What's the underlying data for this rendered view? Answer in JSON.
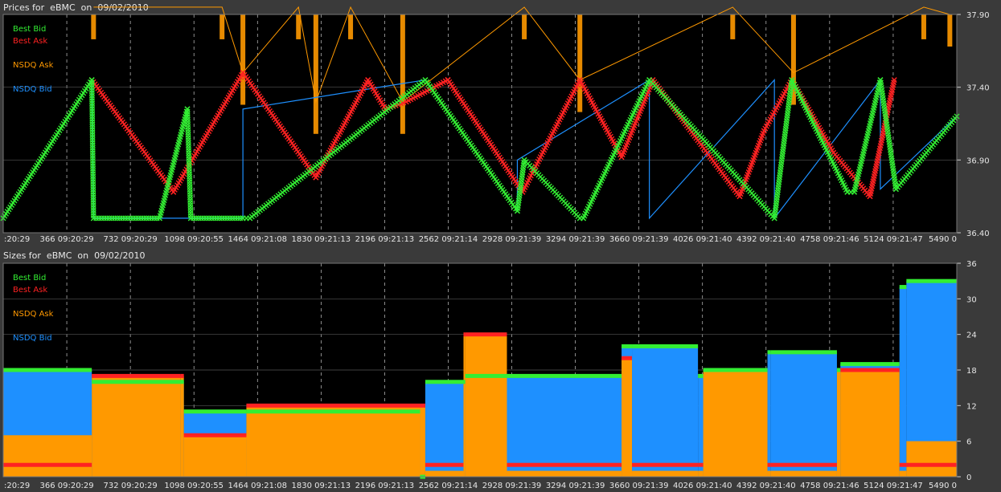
{
  "price_panel": {
    "title": "Prices for  eBMC  on  09/02/2010",
    "legend": [
      "Best Bid",
      "Best Ask",
      "NSDQ Ask",
      "NSDQ Bid"
    ],
    "y_ticks": [
      "37.90",
      "37.40",
      "36.90",
      "36.40"
    ],
    "x_ticks": [
      ":20:29",
      "366 09:20:29",
      "732 09:20:29",
      "1098 09:20:55",
      "1464 09:21:08",
      "1830 09:21:13",
      "2196 09:21:13",
      "2562 09:21:14",
      "2928 09:21:39",
      "3294 09:21:39",
      "3660 09:21:39",
      "4026 09:21:40",
      "4392 09:21:40",
      "4758 09:21:46",
      "5124 09:21:47",
      "5490 0"
    ]
  },
  "size_panel": {
    "title": "Sizes for  eBMC  on  09/02/2010",
    "legend": [
      "Best Bid",
      "Best Ask",
      "NSDQ Ask",
      "NSDQ Bid"
    ],
    "y_ticks": [
      "36",
      "30",
      "24",
      "18",
      "12",
      "6",
      "0"
    ],
    "x_ticks": [
      ":20:29",
      "366 09:20:29",
      "732 09:20:29",
      "1098 09:20:55",
      "1464 09:21:08",
      "1830 09:21:13",
      "2196 09:21:13",
      "2562 09:21:14",
      "2928 09:21:39",
      "3294 09:21:39",
      "3660 09:21:39",
      "4026 09:21:40",
      "4392 09:21:40",
      "4758 09:21:46",
      "5124 09:21:47",
      "5490 0"
    ]
  },
  "colors": {
    "best_bid": "#33ee33",
    "best_ask": "#ff2222",
    "nsdq_ask": "#ff9900",
    "nsdq_bid": "#1e90ff",
    "grid": "#c8c8c8",
    "plot_bg": "#000000",
    "frame_bg": "#3a3a3a"
  },
  "chart_data": [
    {
      "type": "line",
      "title": "Prices for  eBMC  on  09/02/2010",
      "x_range": [
        0,
        5490
      ],
      "ylim": [
        36.4,
        37.9
      ],
      "grid": true,
      "legend_position": "top-left",
      "series": [
        {
          "name": "Best Bid",
          "x": [
            0,
            510,
            520,
            900,
            1060,
            1080,
            1380,
            1420,
            2430,
            2960,
            3000,
            3320,
            3340,
            3720,
            4440,
            4540,
            4860,
            4900,
            5050,
            5140,
            5490
          ],
          "y": [
            36.5,
            37.45,
            36.5,
            36.5,
            37.25,
            36.5,
            36.5,
            36.5,
            37.45,
            36.55,
            36.9,
            36.5,
            36.5,
            37.45,
            36.5,
            37.45,
            36.68,
            36.68,
            37.45,
            36.7,
            37.2
          ]
        },
        {
          "name": "Best Ask",
          "x": [
            510,
            980,
            1380,
            1800,
            2100,
            2200,
            2320,
            2560,
            2560,
            2990,
            3320,
            3560,
            3740,
            4240,
            4380,
            4540,
            4780,
            4990,
            5130
          ],
          "y": [
            37.45,
            36.68,
            37.5,
            36.78,
            37.45,
            37.25,
            37.3,
            37.45,
            37.45,
            36.68,
            37.45,
            36.92,
            37.45,
            36.65,
            37.1,
            37.45,
            36.95,
            36.65,
            37.45
          ]
        },
        {
          "name": "NSDQ Ask",
          "x": [
            520,
            1260,
            1380,
            1700,
            1800,
            2000,
            2300,
            3000,
            3320,
            4200,
            4550,
            5300,
            5450
          ],
          "y": [
            37.95,
            37.95,
            37.5,
            37.95,
            37.3,
            37.95,
            37.3,
            37.95,
            37.45,
            37.95,
            37.5,
            37.95,
            37.9
          ]
        },
        {
          "name": "NSDQ Bid",
          "x": [
            510,
            520,
            1380,
            1380,
            2430,
            2960,
            2960,
            3720,
            3720,
            4440,
            4440,
            5050,
            5050,
            5490
          ],
          "y": [
            37.45,
            36.5,
            36.5,
            37.25,
            37.45,
            36.55,
            36.9,
            37.45,
            36.5,
            37.45,
            36.5,
            37.45,
            36.7,
            37.2
          ]
        }
      ]
    },
    {
      "type": "area",
      "title": "Sizes for  eBMC  on  09/02/2010",
      "x_range": [
        0,
        5490
      ],
      "ylim": [
        0,
        36
      ],
      "grid": true,
      "legend_position": "top-left",
      "series": [
        {
          "name": "NSDQ Bid",
          "x": [
            0,
            500,
            510,
            1020,
            1040,
            1400,
            2400,
            2430,
            2650,
            2660,
            2900,
            3560,
            3620,
            4000,
            4030,
            4400,
            4420,
            4800,
            4820,
            5160,
            5200,
            5490
          ],
          "y": [
            18,
            18,
            16,
            16,
            11,
            11,
            0,
            16,
            16,
            17,
            17,
            22,
            22,
            17,
            18,
            21,
            21,
            18,
            19,
            32,
            33,
            33
          ]
        },
        {
          "name": "NSDQ Ask",
          "x": [
            0,
            500,
            510,
            1020,
            1040,
            1400,
            2400,
            2430,
            2650,
            2660,
            2900,
            3560,
            3620,
            4000,
            4030,
            4400,
            4420,
            4800,
            4820,
            5160,
            5200,
            5490
          ],
          "y": [
            7,
            7,
            17,
            17,
            7,
            12,
            12,
            1,
            24,
            24,
            1,
            20,
            1,
            1,
            18,
            1,
            1,
            18,
            18,
            1,
            6,
            1
          ]
        },
        {
          "name": "Best Ask",
          "x": [
            0,
            500,
            510,
            1020,
            1040,
            1400,
            2400,
            2430,
            2650,
            2660,
            2900,
            3560,
            3620,
            4000,
            4030,
            4400,
            4420,
            4800,
            4820,
            5160,
            5200,
            5490
          ],
          "y": [
            2,
            2,
            17,
            17,
            7,
            12,
            12,
            2,
            24,
            24,
            2,
            20,
            2,
            2,
            18,
            2,
            2,
            18,
            18,
            2,
            2,
            2
          ]
        },
        {
          "name": "Best Bid",
          "x": [
            0,
            500,
            510,
            1020,
            1040,
            1400,
            2400,
            2430,
            2650,
            2660,
            2900,
            3560,
            3620,
            4000,
            4030,
            4400,
            4420,
            4800,
            4820,
            5160,
            5200,
            5490
          ],
          "y": [
            18,
            18,
            16,
            16,
            11,
            11,
            0,
            16,
            16,
            17,
            17,
            22,
            22,
            17,
            18,
            21,
            21,
            18,
            19,
            32,
            33,
            33
          ]
        }
      ]
    }
  ]
}
